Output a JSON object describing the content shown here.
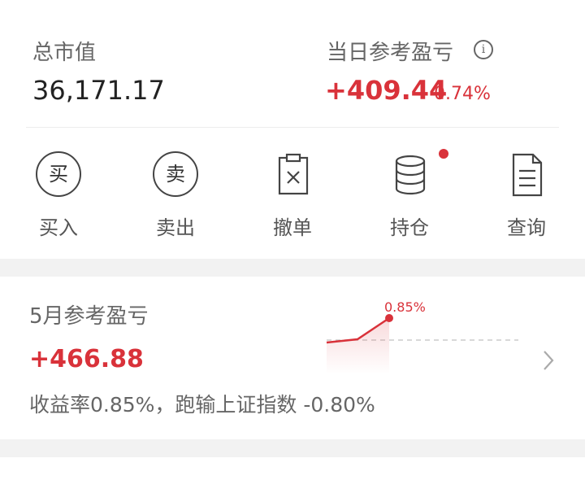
{
  "summary": {
    "total_label": "总市值",
    "total_value": "36,171.17",
    "pnl_label": "当日参考盈亏",
    "pnl_value": "+409.44",
    "pnl_pct": "0.74%"
  },
  "actions": [
    {
      "label": "买入",
      "glyph": "买",
      "icon": "buy-icon"
    },
    {
      "label": "卖出",
      "glyph": "卖",
      "icon": "sell-icon"
    },
    {
      "label": "撤单",
      "icon": "cancel-order-icon"
    },
    {
      "label": "持仓",
      "icon": "holdings-icon"
    },
    {
      "label": "查询",
      "icon": "query-icon"
    }
  ],
  "monthly": {
    "label": "5月参考盈亏",
    "value": "+466.88",
    "desc": "收益率0.85%，跑输上证指数 -0.80%",
    "chart_label": "0.85%"
  },
  "colors": {
    "up_red": "#d9323a",
    "text_gray": "#666666",
    "separator": "#f2f2f2"
  }
}
